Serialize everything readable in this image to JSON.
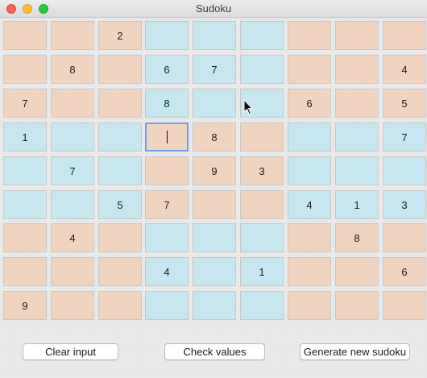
{
  "window": {
    "title": "Sudoku"
  },
  "grid": {
    "values": [
      [
        "",
        "",
        "2",
        "",
        "",
        "",
        "",
        "",
        ""
      ],
      [
        "",
        "8",
        "",
        "6",
        "7",
        "",
        "",
        "",
        "4"
      ],
      [
        "7",
        "",
        "",
        "8",
        "",
        "",
        "6",
        "",
        "5"
      ],
      [
        "1",
        "",
        "",
        "",
        "8",
        "",
        "",
        "",
        "7"
      ],
      [
        "",
        "7",
        "",
        "",
        "9",
        "3",
        "",
        "",
        ""
      ],
      [
        "",
        "",
        "5",
        "7",
        "",
        "",
        "4",
        "1",
        "3"
      ],
      [
        "",
        "4",
        "",
        "",
        "",
        "",
        "",
        "8",
        ""
      ],
      [
        "",
        "",
        "",
        "4",
        "",
        "1",
        "",
        "",
        "6"
      ],
      [
        "9",
        "",
        "",
        "",
        "",
        "",
        "",
        "",
        ""
      ]
    ],
    "colors": {
      "peach": "#f1d4c0",
      "blue": "#c6e7ef",
      "focus": "#6b9ff2"
    },
    "focused_cell": [
      3,
      3
    ]
  },
  "buttons": {
    "clear_label": "Clear input",
    "check_label": "Check values",
    "generate_label": "Generate new sudoku"
  },
  "icons": {
    "mouse_cursor": "arrow-cursor-icon"
  }
}
